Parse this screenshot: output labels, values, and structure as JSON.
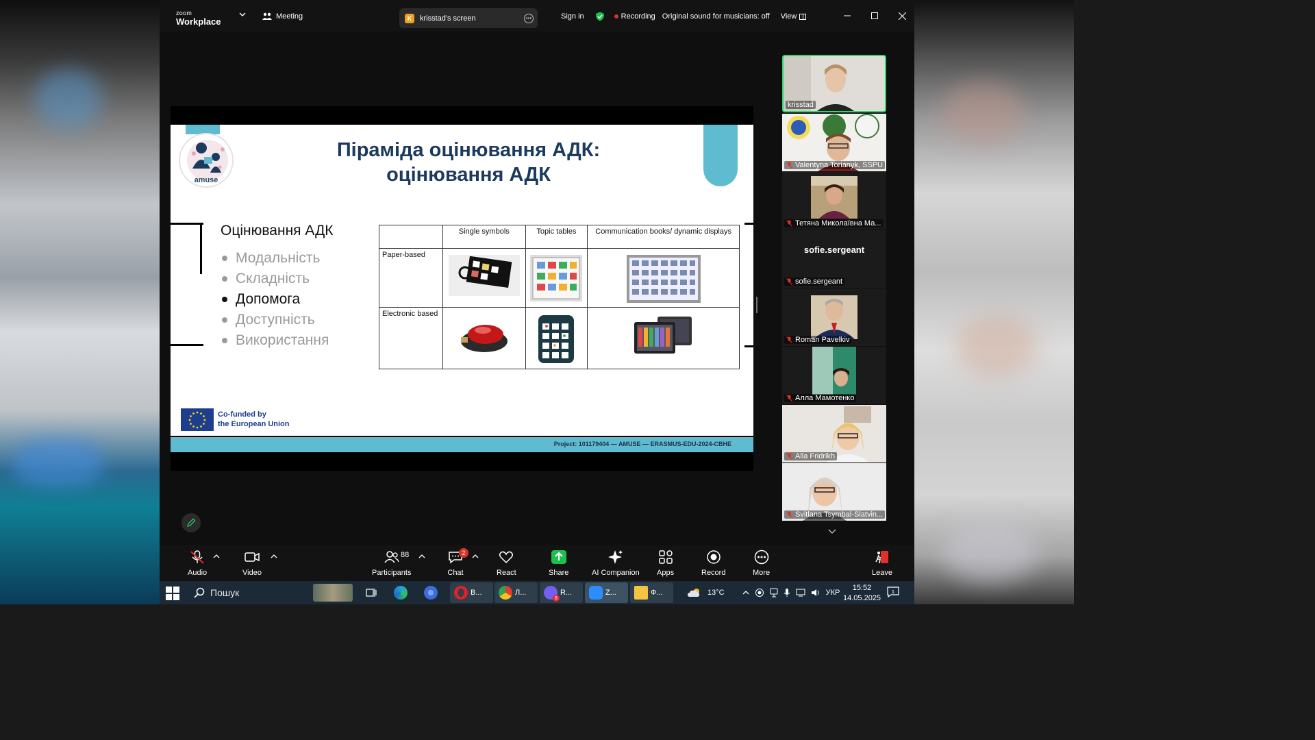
{
  "window": {
    "logo_small": "zoom",
    "logo_big": "Workplace",
    "meeting_label": "Meeting",
    "screen_owner_initial": "K",
    "screen_label": "krisstad's screen",
    "sign_in": "Sign in",
    "recording_label": "Recording",
    "original_sound": "Original sound for musicians: off",
    "view_label": "View"
  },
  "slide": {
    "logo_text": "amuse",
    "title_line1": "Піраміда оцінювання АДК:",
    "title_line2": "оцінювання АДК",
    "list_heading": "Оцінювання АДК",
    "bullets": [
      "Модальність",
      "Складність",
      "Допомога",
      "Доступність",
      "Використання"
    ],
    "active_bullet_index": 2,
    "table": {
      "headers": [
        "",
        "Single symbols",
        "Topic tables",
        "Communication books/ dynamic displays"
      ],
      "rows": [
        "Paper-based",
        "Electronic based"
      ]
    },
    "eu_line1": "Co-funded by",
    "eu_line2": "the European Union",
    "project": "Project: 101179404 — AMUSE — ERASMUS-EDU-2024-CBHE"
  },
  "participants": [
    {
      "name": "krisstad",
      "muted": false,
      "active": true
    },
    {
      "name": "Valentyna Torianyk, SSPU",
      "muted": true
    },
    {
      "name": "Тетяна Миколаївна Ма...",
      "muted": true
    },
    {
      "name": "sofie.sergeant",
      "muted": true,
      "big_name": "sofie.sergeant"
    },
    {
      "name": "Roman Pavelkiv",
      "muted": true
    },
    {
      "name": "Алла Мамотенко",
      "muted": true
    },
    {
      "name": "Alla Fridrikh",
      "muted": true
    },
    {
      "name": "Svitlana Tsymbal-Slatvin...",
      "muted": true
    }
  ],
  "toolbar": {
    "audio": "Audio",
    "video": "Video",
    "participants": "Participants",
    "participants_count": "88",
    "chat": "Chat",
    "chat_badge": "2",
    "react": "React",
    "share": "Share",
    "ai_companion": "AI Companion",
    "apps": "Apps",
    "record": "Record",
    "more": "More",
    "leave": "Leave"
  },
  "taskbar": {
    "search_label": "Пошук",
    "apps": [
      {
        "label": "В...",
        "icon": "opera-icon"
      },
      {
        "label": "Л...",
        "icon": "chrome-icon"
      },
      {
        "label": "R...",
        "icon": "viber-icon",
        "badge": "8"
      },
      {
        "label": "Z...",
        "icon": "zoom-icon"
      },
      {
        "label": "Ф...",
        "icon": "folder-icon"
      }
    ],
    "weather": "13°C",
    "language": "УКР",
    "time": "15:52",
    "date": "14.05.2025",
    "notification_count": "1"
  },
  "colors": {
    "accent_teal": "#5fbcd0",
    "title_navy": "#1c3a5e",
    "active_speaker": "#2bd66b",
    "recording_red": "#e0302a",
    "share_green": "#1fbf4f"
  }
}
